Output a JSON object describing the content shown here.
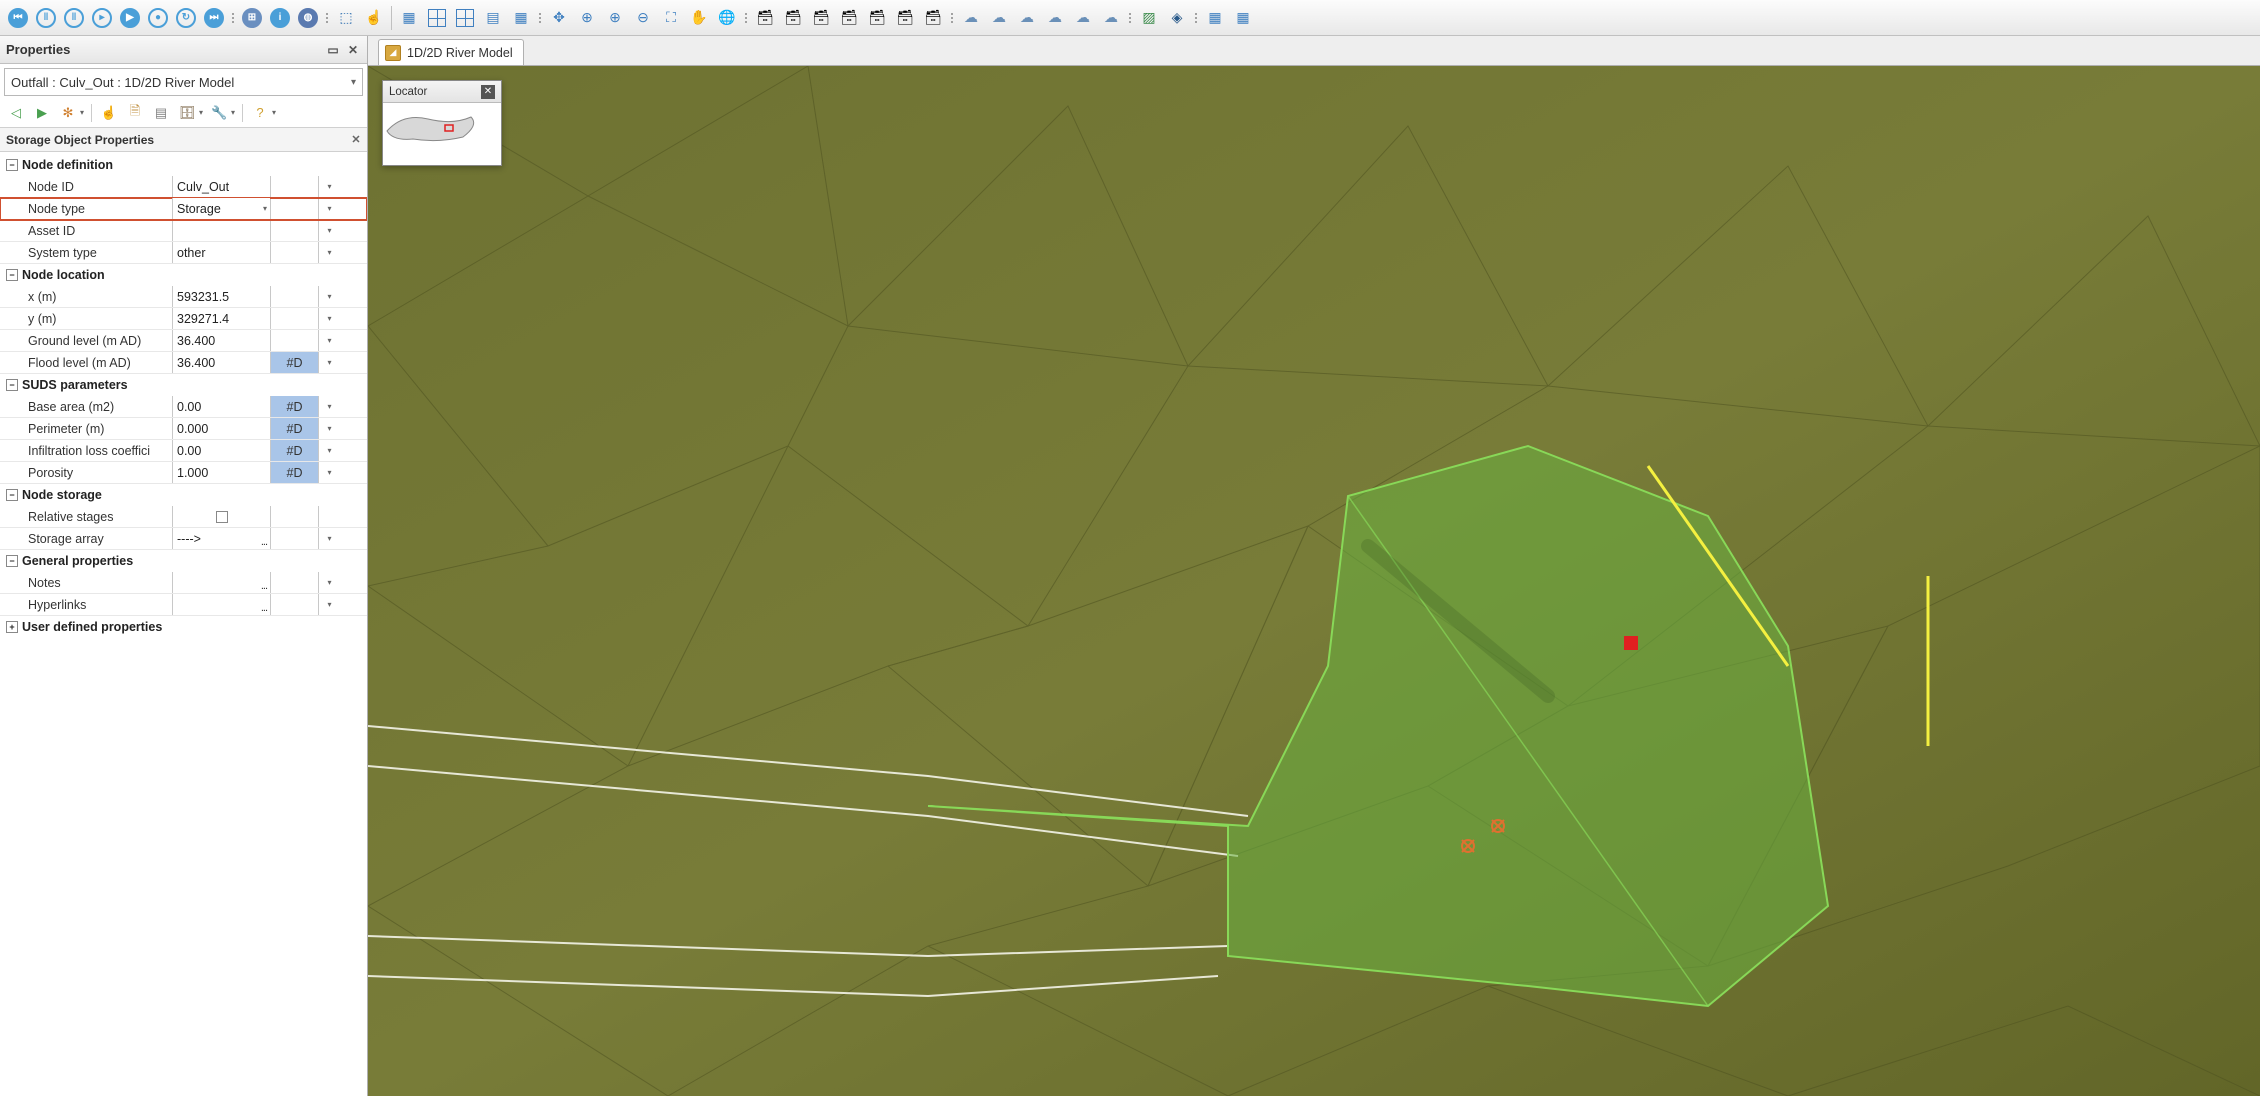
{
  "toolbar": {
    "playback": [
      "skip-back",
      "pause",
      "step-back",
      "step-fwd",
      "play",
      "record",
      "loop",
      "skip-fwd"
    ],
    "misc": [
      "grid-a",
      "info",
      "globe"
    ]
  },
  "panel": {
    "title": "Properties",
    "object_path": "Outfall : Culv_Out : 1D/2D River Model",
    "subpanel_title": "Storage Object Properties"
  },
  "groups": [
    {
      "name": "Node definition",
      "expanded": true,
      "rows": [
        {
          "label": "Node ID",
          "value": "Culv_Out",
          "flag": "",
          "dd": false,
          "end": true
        },
        {
          "label": "Node type",
          "value": "Storage",
          "flag": "",
          "dd": true,
          "end": true,
          "highlight": true
        },
        {
          "label": "Asset ID",
          "value": "",
          "flag": "",
          "dd": false,
          "end": true
        },
        {
          "label": "System type",
          "value": "other",
          "flag": "",
          "dd": false,
          "end": true
        }
      ]
    },
    {
      "name": "Node location",
      "expanded": true,
      "rows": [
        {
          "label": "x (m)",
          "value": "593231.5",
          "flag": "",
          "end": true
        },
        {
          "label": "y (m)",
          "value": "329271.4",
          "flag": "",
          "end": true
        },
        {
          "label": "Ground level (m AD)",
          "value": "36.400",
          "flag": "",
          "end": true
        },
        {
          "label": "Flood level (m AD)",
          "value": "36.400",
          "flag": "#D",
          "end": true
        }
      ]
    },
    {
      "name": "SUDS parameters",
      "expanded": true,
      "rows": [
        {
          "label": "Base area (m2)",
          "value": "0.00",
          "flag": "#D",
          "end": true
        },
        {
          "label": "Perimeter (m)",
          "value": "0.000",
          "flag": "#D",
          "end": true
        },
        {
          "label": "Infiltration loss coeffici",
          "value": "0.00",
          "flag": "#D",
          "end": true
        },
        {
          "label": "Porosity",
          "value": "1.000",
          "flag": "#D",
          "end": true
        }
      ]
    },
    {
      "name": "Node storage",
      "expanded": true,
      "rows": [
        {
          "label": "Relative stages",
          "value": "",
          "flag": "",
          "chk": true,
          "end": false
        },
        {
          "label": "Storage array",
          "value": "---->",
          "flag": "",
          "dots": true,
          "end": true
        }
      ]
    },
    {
      "name": "General properties",
      "expanded": true,
      "rows": [
        {
          "label": "Notes",
          "value": "",
          "flag": "",
          "dots": true,
          "end": true
        },
        {
          "label": "Hyperlinks",
          "value": "",
          "flag": "",
          "dots": true,
          "end": true
        }
      ]
    },
    {
      "name": "User defined properties",
      "expanded": false,
      "rows": []
    }
  ],
  "viewport": {
    "tab_label": "1D/2D River Model",
    "locator_title": "Locator"
  }
}
